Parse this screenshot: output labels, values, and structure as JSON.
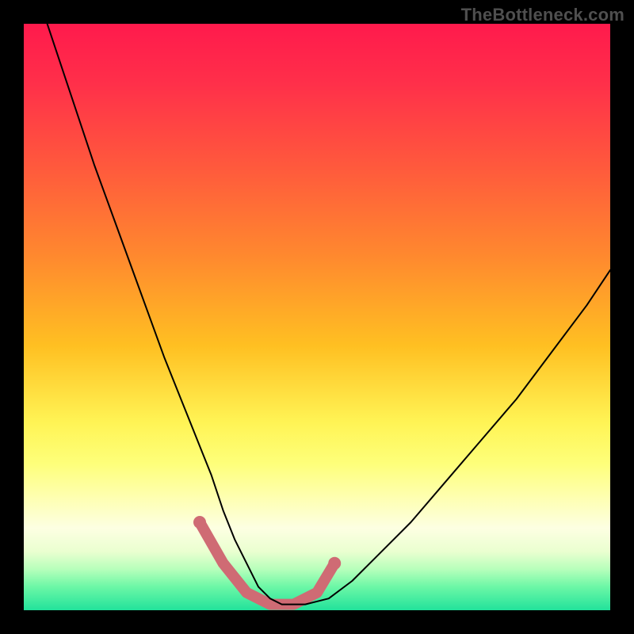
{
  "watermark": {
    "text": "TheBottleneck.com"
  },
  "colors": {
    "background": "#000000",
    "curve": "#000000",
    "highlight": "#cf6b74",
    "gradient_top": "#ff1a4c",
    "gradient_bottom": "#22e29b"
  },
  "chart_data": {
    "type": "line",
    "title": "",
    "xlabel": "",
    "ylabel": "",
    "xlim": [
      0,
      100
    ],
    "ylim": [
      0,
      100
    ],
    "grid": false,
    "series": [
      {
        "name": "bottleneck-curve",
        "x": [
          4,
          8,
          12,
          16,
          20,
          24,
          28,
          32,
          34,
          36,
          38,
          40,
          42,
          44,
          48,
          52,
          56,
          60,
          66,
          72,
          78,
          84,
          90,
          96,
          100
        ],
        "y": [
          100,
          88,
          76,
          65,
          54,
          43,
          33,
          23,
          17,
          12,
          8,
          4,
          2,
          1,
          1,
          2,
          5,
          9,
          15,
          22,
          29,
          36,
          44,
          52,
          58
        ]
      }
    ],
    "highlight": {
      "note": "pink rounded segment near valley floor",
      "x": [
        30,
        34,
        38,
        42,
        46,
        50,
        53
      ],
      "y": [
        15,
        8,
        3,
        1,
        1,
        3,
        8
      ]
    }
  }
}
